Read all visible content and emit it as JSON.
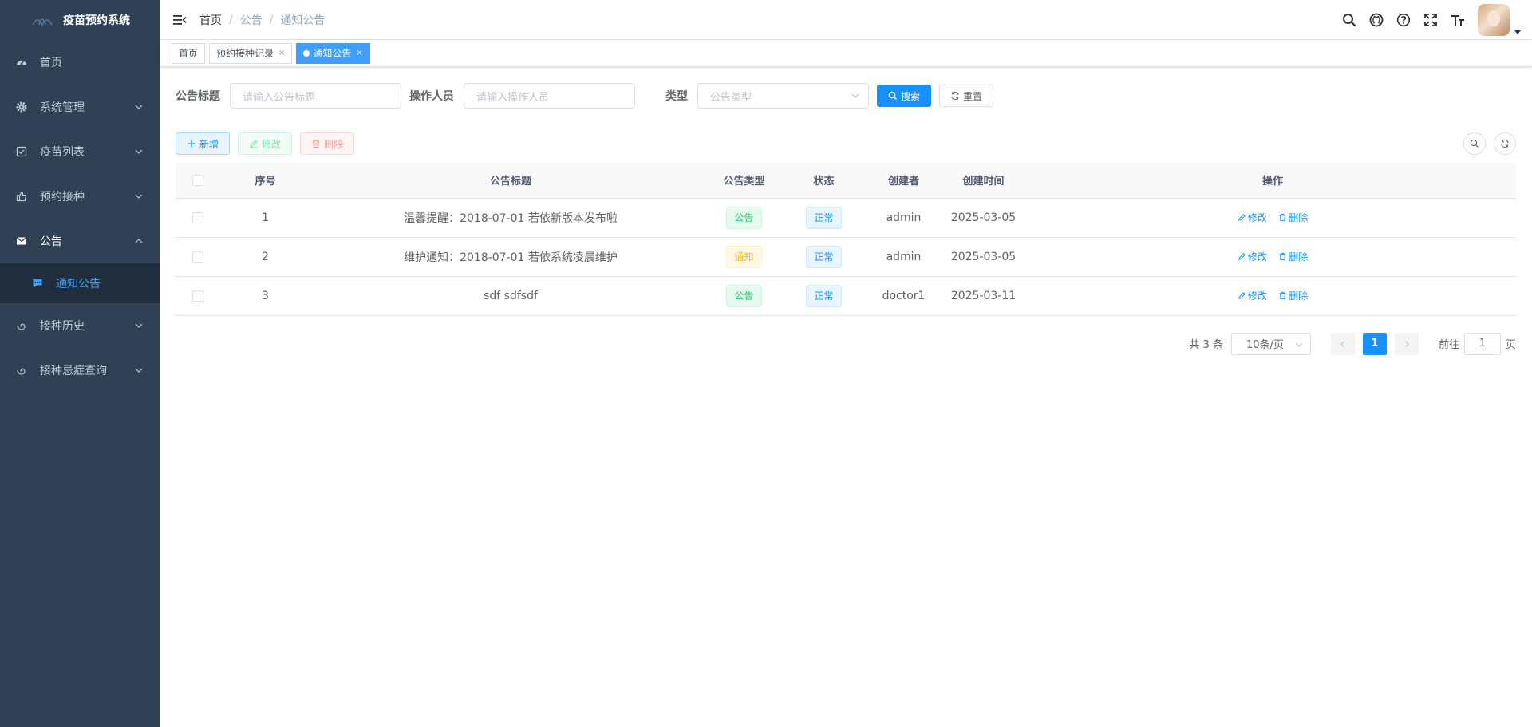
{
  "app": {
    "title": "疫苗预约系统"
  },
  "sidebar": {
    "items": [
      {
        "label": "首页",
        "icon": "dashboard-icon"
      },
      {
        "label": "系统管理",
        "icon": "gear-icon"
      },
      {
        "label": "疫苗列表",
        "icon": "checkbox-icon"
      },
      {
        "label": "预约接种",
        "icon": "thumb-icon"
      },
      {
        "label": "公告",
        "icon": "mail-icon"
      },
      {
        "label": "接种历史",
        "icon": "spiral-icon"
      },
      {
        "label": "接种忌症查询",
        "icon": "spiral-icon"
      }
    ],
    "subitem": {
      "label": "通知公告",
      "icon": "message-icon"
    }
  },
  "breadcrumb": [
    "首页",
    "公告",
    "通知公告"
  ],
  "tags": [
    {
      "label": "首页"
    },
    {
      "label": "预约接种记录",
      "close": "×"
    },
    {
      "label": "通知公告",
      "close": "×"
    }
  ],
  "search": {
    "title_label": "公告标题",
    "title_placeholder": "请输入公告标题",
    "operator_label": "操作人员",
    "operator_placeholder": "请输入操作人员",
    "type_label": "类型",
    "type_placeholder": "公告类型",
    "search_btn": "搜索",
    "reset_btn": "重置"
  },
  "toolbar": {
    "add": "新增",
    "edit": "修改",
    "delete": "删除"
  },
  "table": {
    "headers": [
      "序号",
      "公告标题",
      "公告类型",
      "状态",
      "创建者",
      "创建时间",
      "操作"
    ],
    "rows": [
      {
        "no": "1",
        "title": "温馨提醒：2018-07-01 若依新版本发布啦",
        "type": "公告",
        "status": "正常",
        "creator": "admin",
        "created": "2025-03-05",
        "edit": "修改",
        "delete": "删除"
      },
      {
        "no": "2",
        "title": "维护通知：2018-07-01 若依系统凌晨维护",
        "type": "通知",
        "status": "正常",
        "creator": "admin",
        "created": "2025-03-05",
        "edit": "修改",
        "delete": "删除"
      },
      {
        "no": "3",
        "title": "sdf sdfsdf",
        "type": "公告",
        "status": "正常",
        "creator": "doctor1",
        "created": "2025-03-11",
        "edit": "修改",
        "delete": "删除"
      }
    ]
  },
  "pagination": {
    "total": "共 3 条",
    "page_size": "10条/页",
    "current": "1",
    "goto_label": "前往",
    "goto_value": "1",
    "page_suffix": "页"
  },
  "colors": {
    "sidebar_bg": "#304156",
    "primary": "#1890ff",
    "success": "#13ce66",
    "warning": "#ffba00",
    "danger": "#ff4949"
  }
}
